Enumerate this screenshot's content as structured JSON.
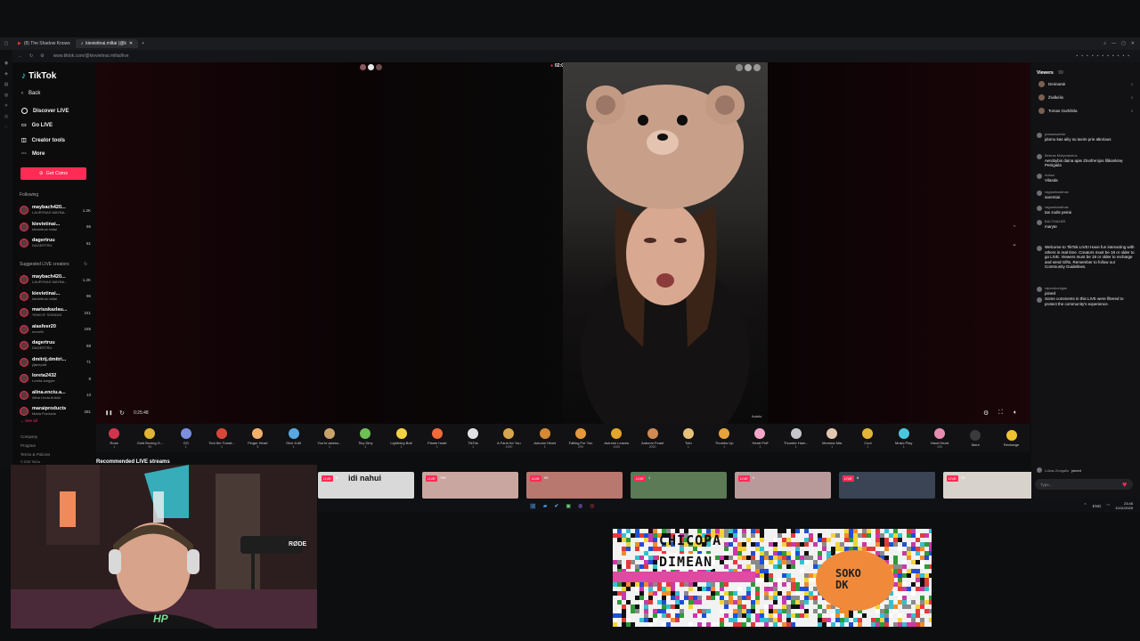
{
  "browser": {
    "tabs": [
      {
        "label": "(8) The Shadow Knows"
      },
      {
        "label": "kievietinai.miltai (@k"
      }
    ],
    "url": "www.tiktok.com/@kievietinai.miltai/live"
  },
  "sidebar": {
    "logo": "TikTok",
    "back": "Back",
    "nav": [
      {
        "label": "Discover LIVE",
        "icon": "live-icon"
      },
      {
        "label": "Go LIVE",
        "icon": "camera-icon"
      },
      {
        "label": "Creator tools",
        "icon": "tools-icon"
      },
      {
        "label": "More",
        "icon": "more-icon"
      }
    ],
    "coins_button": "Get Coins",
    "following_label": "Following",
    "following": [
      {
        "name": "maybach420...",
        "sub": "LAURYNAS MAYBA...",
        "count": "1.2K"
      },
      {
        "name": "kievietinai...",
        "sub": "kievietinai miltai",
        "count": "95"
      },
      {
        "name": "dagertruu",
        "sub": "DAGERTRU",
        "count": "61"
      }
    ],
    "suggested_label": "Suggested LIVE creators",
    "suggested": [
      {
        "name": "maybach420...",
        "sub": "LAURYNAS MAYBA...",
        "count": "1.2K"
      },
      {
        "name": "kievietinai...",
        "sub": "kievietinai miltai",
        "count": "96"
      },
      {
        "name": "mariuskazlau...",
        "sub": "*EMOJI* SOMZAS",
        "count": "241"
      },
      {
        "name": "aiasfeer20",
        "sub": "mcxeth",
        "count": "165"
      },
      {
        "name": "dagertruu",
        "sub": "DAGERTRU",
        "count": "58"
      },
      {
        "name": "dmitrij.dmitri...",
        "sub": "Дмитрий",
        "count": "71"
      },
      {
        "name": "loreta2432",
        "sub": "Loreta sargyte",
        "count": "8"
      },
      {
        "name": "alina.enciu.a...",
        "sub": "Alina Linda Anklai",
        "count": "13"
      },
      {
        "name": "maraiproducts",
        "sub": "Maria Products",
        "count": "281"
      }
    ],
    "see_all": "See all",
    "footer": [
      "Company",
      "Program",
      "Terms & Policies",
      "© 2025 TikTok"
    ]
  },
  "video": {
    "timer": "02:01",
    "elapsed": "0:25:48",
    "watermark": "Autolu"
  },
  "gifts": [
    {
      "name": "Rose",
      "price": "1",
      "color": "#d2354b"
    },
    {
      "name": "Gold Boxing G...",
      "price": "50",
      "color": "#e0b533"
    },
    {
      "name": "GG",
      "price": "1",
      "color": "#7b8fe0"
    },
    {
      "name": "Tom the Tomat...",
      "price": "1",
      "color": "#d9473a"
    },
    {
      "name": "Finger Heart",
      "price": "5",
      "color": "#f2b06b"
    },
    {
      "name": "Give It All",
      "price": "1",
      "color": "#58a9e3"
    },
    {
      "name": "You're aweso...",
      "price": "1",
      "color": "#c8a36b"
    },
    {
      "name": "Tiny Diny",
      "price": "1",
      "color": "#6fbf57"
    },
    {
      "name": "Lightning Bolt",
      "price": "1",
      "color": "#f5d341"
    },
    {
      "name": "Flame heart",
      "price": "1",
      "color": "#f06a3a"
    },
    {
      "name": "TikTok",
      "price": "1",
      "color": "#e2e2e2"
    },
    {
      "name": "A Farm for You",
      "price": "1000",
      "color": "#d8a550"
    },
    {
      "name": "Autumn Heart",
      "price": "1",
      "color": "#d48934"
    },
    {
      "name": "Falling For You",
      "price": "299",
      "color": "#e49a3c"
    },
    {
      "name": "Autumn Leaves",
      "price": "1000",
      "color": "#e3a62a"
    },
    {
      "name": "Autumn Feast",
      "price": "2000",
      "color": "#cf8a55"
    },
    {
      "name": "Tofu",
      "price": "1",
      "color": "#e7c27a"
    },
    {
      "name": "Thumbs Up",
      "price": "1",
      "color": "#e6a33d"
    },
    {
      "name": "Heart Puff",
      "price": "1",
      "color": "#f3a6c7"
    },
    {
      "name": "Thunder Ham...",
      "price": "1",
      "color": "#c6c6ce"
    },
    {
      "name": "Momma Mia",
      "price": "1",
      "color": "#e3c7b0"
    },
    {
      "name": "Cool",
      "price": "1",
      "color": "#e4b539"
    },
    {
      "name": "Music Play",
      "price": "1",
      "color": "#4cc6df"
    },
    {
      "name": "Hand Heart",
      "price": "100",
      "color": "#e88bb0"
    },
    {
      "name": "More",
      "price": "",
      "color": "#3a3a3e"
    },
    {
      "name": "Recharge",
      "price": "",
      "color": "#f0c232"
    }
  ],
  "recommended": {
    "title": "Recommended LIVE streams",
    "streams": [
      {
        "live": "LIVE",
        "viewers": "8",
        "caption": "idi nahui",
        "color": "#d9d9d9"
      },
      {
        "live": "LIVE",
        "viewers": "765",
        "caption": "",
        "color": "#caa6a0"
      },
      {
        "live": "LIVE",
        "viewers": "90",
        "caption": "",
        "color": "#b87870"
      },
      {
        "live": "LIVE",
        "viewers": "1",
        "caption": "",
        "color": "#5b7a55"
      },
      {
        "live": "LIVE",
        "viewers": "0",
        "caption": "",
        "color": "#b89a9a"
      },
      {
        "live": "LIVE",
        "viewers": "8",
        "caption": "",
        "color": "#3a4455"
      },
      {
        "live": "LIVE",
        "viewers": "23",
        "caption": "",
        "color": "#d8d2cc"
      }
    ]
  },
  "chat": {
    "viewers_label": "Viewers",
    "viewers_count": "99",
    "viewers": [
      {
        "name": "Deimantė",
        "count": "0"
      },
      {
        "name": "Živilkėlis",
        "count": "0"
      },
      {
        "name": "Tomas Gurkšėla",
        "count": "0"
      }
    ],
    "messages": [
      {
        "user": "jowasaweida",
        "text": "jdomu kas ailiy su tavim prie altoriaus"
      },
      {
        "user": "Bebras Motyvatorius",
        "text": "Aerobybis daina apie Zinofrenijos šlikankinę Petrigaila"
      },
      {
        "user": "Aukso",
        "text": "Vilasda"
      },
      {
        "user": "ragusekaslinas",
        "text": "saremiai"
      },
      {
        "user": "ragusekaslinas",
        "text": "tas zodis peirai"
      },
      {
        "user": "BALTHAZAR",
        "text": "maryte"
      },
      {
        "user": "",
        "text": "Welcome to TikTok LIVE! Have fun interacting with others in real time. Creators must be 18 or older to go LIVE. Viewers must be 18 or older to recharge and send Gifts. Remember to follow our Community Guidelines."
      },
      {
        "user": "rajonokonigas",
        "text": "joined"
      },
      {
        "user": "",
        "text": "Some comments in this LIVE were filtered to protect the community's experience."
      }
    ],
    "joined_user": "Lukas Zongailo",
    "joined_text": "joined",
    "input_placeholder": "Type..."
  },
  "taskbar": {
    "time": "23:45",
    "date": "10/11/2025",
    "lang": "ENG"
  },
  "webcam": {
    "mic_brand": "RØDE",
    "logo_text": "HP"
  },
  "pixel_art": {
    "text_line1": "CHICOPA",
    "text_line2": "DIMEAN",
    "text_line3": "SOKO DK"
  }
}
